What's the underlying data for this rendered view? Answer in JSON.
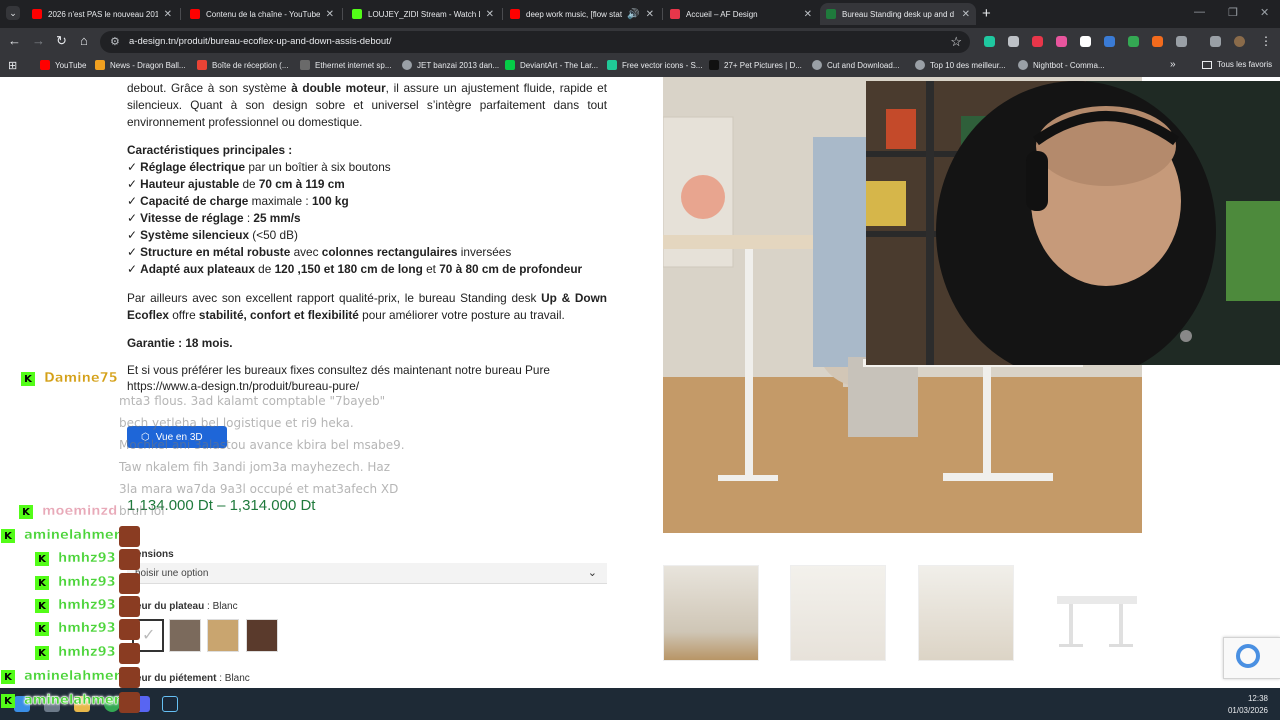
{
  "tabs": [
    {
      "title": "2026 n'est PAS le nouveau 2016",
      "favicon_color": "#ff0000"
    },
    {
      "title": "Contenu de la chaîne - YouTube",
      "favicon_color": "#ff0000"
    },
    {
      "title": "LOUJEY_ZIDI Stream - Watch Li",
      "favicon_color": "#53fc18"
    },
    {
      "title": "deep work music, [flow stat",
      "favicon_color": "#ff0000"
    },
    {
      "title": "Accueil – AF Design",
      "favicon_color": "#e8364a"
    },
    {
      "title": "Bureau Standing desk up and d",
      "favicon_color": "#1f7a3c"
    }
  ],
  "toolbar": {
    "url": "a-design.tn/produit/bureau-ecoflex-up-and-down-assis-debout/"
  },
  "bookmarks": {
    "items": [
      {
        "label": "YouTube",
        "color": "#ff0000"
      },
      {
        "label": "News - Dragon Ball...",
        "color": "#f0a020"
      },
      {
        "label": "Boîte de réception (...",
        "color": "#ea4335"
      },
      {
        "label": "Ethernet internet sp...",
        "color": "#6a6a6a"
      },
      {
        "label": "JET banzai 2013 dan...",
        "color": "#9aa0a6"
      },
      {
        "label": "DeviantArt - The Lar...",
        "color": "#05cc47"
      },
      {
        "label": "Free vector icons - S...",
        "color": "#20c997"
      },
      {
        "label": "27+ Pet Pictures | D...",
        "color": "#111111"
      },
      {
        "label": "Cut and Download...",
        "color": "#9aa0a6"
      },
      {
        "label": "Top 10 des meilleur...",
        "color": "#9aa0a6"
      },
      {
        "label": "Nightbot - Comma...",
        "color": "#9aa0a6"
      }
    ],
    "all": "Tous les favoris"
  },
  "product": {
    "intro_1": "debout. Grâce à son système ",
    "intro_bold": "à double moteur",
    "intro_2": ", il assure un ajustement fluide, rapide et silencieux. Quant à son design sobre et universel s’intègre parfaitement dans tout environnement professionnel ou domestique.",
    "features_title": "Caractéristiques principales :",
    "features": [
      {
        "bold": "Réglage électrique",
        "rest": " par un boîtier à six boutons"
      },
      {
        "bold": "Hauteur ajustable",
        "rest": " de ",
        "bold2": "70 cm à 119 cm"
      },
      {
        "bold": "Capacité de charge",
        "rest": " maximale : ",
        "bold2": "100 kg"
      },
      {
        "bold": "Vitesse de réglage",
        "rest": " : ",
        "bold2": "25 mm/s"
      },
      {
        "bold": "Système silencieux",
        "rest": " (<50 dB)"
      },
      {
        "bold": "Structure en métal robuste",
        "rest": " avec ",
        "bold2": "colonnes rectangulaires",
        "rest2": " inversées"
      },
      {
        "bold": "Adapté aux plateaux",
        "rest": " de ",
        "bold2": "120 ,150 et 180 cm de long",
        "rest2": " et ",
        "bold3": "70 à 80 cm de profondeur"
      }
    ],
    "value_1": "Par ailleurs avec son excellent rapport qualité-prix, le bureau Standing desk ",
    "value_bold1": "Up & Down Ecoflex",
    "value_2": " offre ",
    "value_bold2": "stabilité, confort et flexibilité",
    "value_3": " pour améliorer votre posture au travail.",
    "garantie": "Garantie : 18 mois.",
    "fixed_1": "Et si vous préférer les bureaux fixes consultez dés maintenant notre bureau Pure",
    "fixed_link": "https://www.a-design.tn/produit/bureau-pure/",
    "btn_3d": "Vue en 3D",
    "price": "1,134.000 Dt  –  1,314.000 Dt",
    "dim_label": "mensions",
    "dim_placeholder": "hoisir une option",
    "color_label": "uleur du plateau",
    "color_value": " : Blanc",
    "pied_label": "uleur du piétement",
    "pied_value": " : Blanc",
    "swatches": [
      "#ffffff",
      "#7b6a5c",
      "#c9a56f",
      "#5a3a2c"
    ]
  },
  "chat": {
    "users": [
      {
        "name": "Damine75",
        "color": "#d4a017"
      },
      {
        "name": "moeminzd",
        "color": "#e8a9b8"
      },
      {
        "name": "aminelahmer",
        "color": "#4cd43a"
      },
      {
        "name": "hmhz93",
        "color": "#4cd43a"
      },
      {
        "name": "hmhz93",
        "color": "#4cd43a"
      },
      {
        "name": "hmhz93",
        "color": "#4cd43a"
      },
      {
        "name": "hmhz93",
        "color": "#4cd43a"
      },
      {
        "name": "hmhz93",
        "color": "#4cd43a"
      },
      {
        "name": "aminelahmer",
        "color": "#4cd43a"
      },
      {
        "name": "aminelahmer",
        "color": "#4cd43a"
      }
    ],
    "messages": [
      "mta3 flous. 3ad kalamt comptable \"7bayeb\"",
      "bech yetleha bel logistique et ri9 heka.",
      "Mochkel ani 3alastou avance kbira bel msabe9.",
      "Taw nkalem fih 3andi jom3a mayhezech. Haz",
      "3la mara wa7da 9a3l occupé et mat3afech XD",
      "bruh lol"
    ]
  },
  "clock": {
    "time": "12:38",
    "date": "01/03/2026"
  }
}
